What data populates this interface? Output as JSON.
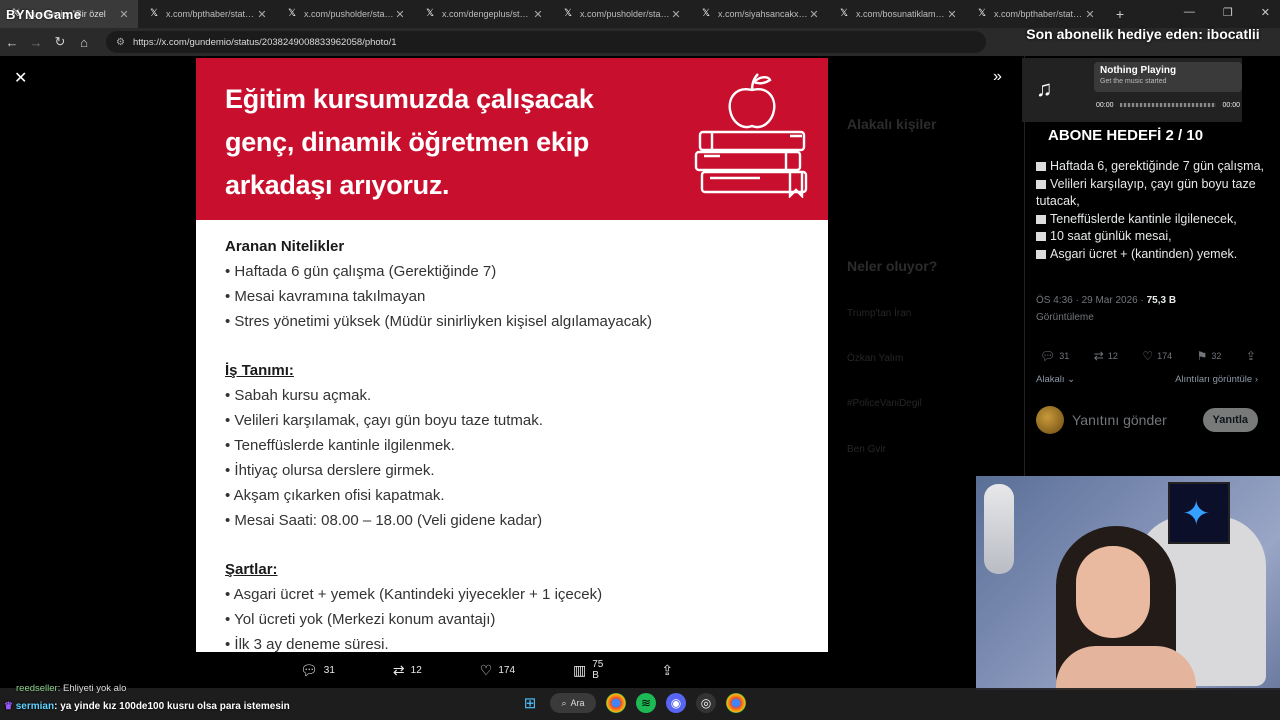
{
  "tabs": [
    {
      "title": "gundemio: \"Bir özel",
      "active": true
    },
    {
      "title": "x.com/bpthaber/status/2",
      "active": false
    },
    {
      "title": "x.com/pusholder/status/2",
      "active": false
    },
    {
      "title": "x.com/dengeplus/status/2",
      "active": false
    },
    {
      "title": "x.com/pusholder/status/2",
      "active": false
    },
    {
      "title": "x.com/siyahsancakx/stat",
      "active": false
    },
    {
      "title": "x.com/bosunatiklama/sta",
      "active": false
    },
    {
      "title": "x.com/bpthaber/status/2",
      "active": false
    }
  ],
  "brand_overlay": "BYNoGame",
  "address": {
    "url": "https://x.com/gundemio/status/2038249008833962058/photo/1"
  },
  "photo": {
    "headline": "Eğitim kursumuzda çalışacak genç, dinamik öğretmen ekip arkadaşı arıyoruz.",
    "sections": [
      {
        "title": "Aranan Nitelikler",
        "underline": false,
        "lines": [
          "• Haftada 6 gün çalışma (Gerektiğinde 7)",
          "• Mesai kavramına takılmayan",
          "• Stres yönetimi yüksek (Müdür sinirliyken kişisel algılamayacak)"
        ]
      },
      {
        "title": "İş Tanımı:",
        "underline": true,
        "lines": [
          "• Sabah kursu açmak.",
          "• Velileri karşılamak, çayı gün boyu taze tutmak.",
          "• Teneffüslerde kantinle ilgilenmek.",
          "• İhtiyaç olursa derslere girmek.",
          "• Akşam çıkarken ofisi kapatmak.",
          "• Mesai Saati: 08.00 – 18.00 (Veli gidene kadar)"
        ]
      },
      {
        "title": "Şartlar:",
        "underline": true,
        "lines": [
          "• Asgari ücret + yemek (Kantindeki yiyecekler + 1 içecek)",
          "• Yol ücreti yok (Merkezi konum avantajı)",
          "• İlk 3 ay deneme süresi."
        ]
      }
    ]
  },
  "stats": {
    "replies": "31",
    "reposts": "12",
    "likes": "174",
    "views": "75 B"
  },
  "ghost": {
    "related": "Alakalı kişiler",
    "whats_happening": "Neler oluyor?",
    "trend1": "Trump'tan İran",
    "trend2": "Özkan Yalım",
    "trend3": "#PoliceVaniDegil",
    "trend4": "Ben Gvir"
  },
  "overlay": {
    "subscriber_text": "Son abonelik hediye eden: ibocatlii",
    "goal": "ABONE HEDEFİ 2 / 10"
  },
  "music": {
    "title": "Nothing Playing",
    "subtitle": "Get the music started",
    "time_start": "00:00",
    "time_end": "00:00"
  },
  "tweet": {
    "lines": [
      "Haftada 6, gerektiğinde 7 gün çalışma,",
      "Velileri karşılayıp, çayı gün boyu taze tutacak,",
      "Teneffüslerde kantinle ilgilenecek,",
      "10 saat günlük mesai,",
      "Asgari ücret + (kantinden) yemek."
    ],
    "time": "ÖS 4:36 · 29 Mar 2026 ·",
    "views_count": "75,3 B",
    "views_label": "Görüntüleme",
    "replies": "31",
    "reposts": "12",
    "likes": "174",
    "bookmarks": "32",
    "sort_label": "Alakalı",
    "quotes_label": "Alıntıları görüntüle",
    "reply_placeholder": "Yanıtını gönder",
    "reply_button": "Yanıtla"
  },
  "chat": [
    {
      "user": "reedseller",
      "text": ": Ehliyeti yok alo"
    },
    {
      "user": "sermian",
      "text": ": ya yinde kız 100de100 kusru olsa para istemesin"
    }
  ],
  "taskbar": {
    "search_label": "Ara"
  }
}
